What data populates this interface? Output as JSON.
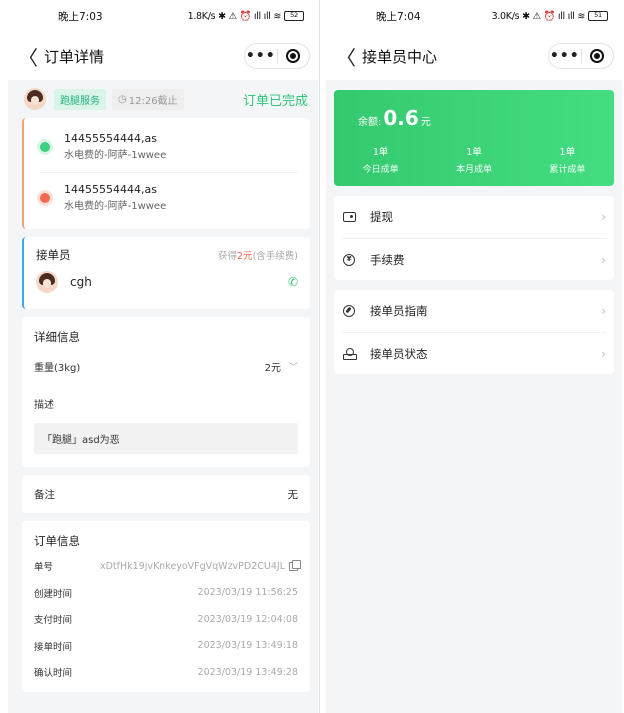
{
  "left": {
    "status": {
      "time": "晚上7:03",
      "speed": "1.8K/s",
      "signal": "✱ ⚠ ⏰ ıll ıll ≋",
      "battery": "52"
    },
    "nav": {
      "back": "〈",
      "title": "订单详情",
      "more": "•••"
    },
    "header": {
      "service_tag": "跑腿服务",
      "deadline": "12:26截止",
      "status": "订单已完成"
    },
    "addresses": [
      {
        "phone": "14455554444,as",
        "detail": "水电费的-阿萨-1wwee"
      },
      {
        "phone": "14455554444,as",
        "detail": "水电费的-阿萨-1wwee"
      }
    ],
    "taker": {
      "label": "接单员",
      "earn_prefix": "获得",
      "earn_amount": "2元",
      "earn_suffix": "(含手续费)",
      "name": "cgh"
    },
    "detail": {
      "title": "详细信息",
      "weight_label": "重量(3kg)",
      "weight_value": "2元",
      "desc_label": "描述",
      "desc_value": "「跑腿」asd为恶"
    },
    "remark": {
      "label": "备注",
      "value": "无"
    },
    "order_info": {
      "title": "订单信息",
      "rows": [
        {
          "key": "单号",
          "value": "xDtfHk19jvKnkeyoVFgVqWzvPD2CU4JL"
        },
        {
          "key": "创建时间",
          "value": "2023/03/19 11:56:25"
        },
        {
          "key": "支付时间",
          "value": "2023/03/19 12:04:08"
        },
        {
          "key": "接单时间",
          "value": "2023/03/19 13:49:18"
        },
        {
          "key": "确认时间",
          "value": "2023/03/19 13:49:28"
        }
      ]
    }
  },
  "right": {
    "status": {
      "time": "晚上7:04",
      "speed": "3.0K/s",
      "signal": "✱ ⚠ ⏰ ıll ıll ≋",
      "battery": "51"
    },
    "nav": {
      "back": "〈",
      "title": "接单员中心",
      "more": "•••"
    },
    "balance": {
      "label": "余额:",
      "value": "0.6",
      "unit": "元",
      "stats": [
        {
          "value": "1单",
          "label": "今日成单"
        },
        {
          "value": "1单",
          "label": "本月成单"
        },
        {
          "value": "1单",
          "label": "累计成单"
        }
      ]
    },
    "menu_groups": [
      [
        {
          "label": "提现",
          "icon": "wallet-icon"
        },
        {
          "label": "手续费",
          "icon": "coin-icon"
        }
      ],
      [
        {
          "label": "接单员指南",
          "icon": "compass-icon"
        },
        {
          "label": "接单员状态",
          "icon": "stamp-icon"
        }
      ]
    ],
    "arrow": "›"
  },
  "colors": {
    "accent_green": "#2fc77c",
    "price_red": "#f0624a",
    "taker_blue": "#3aa8f0"
  }
}
